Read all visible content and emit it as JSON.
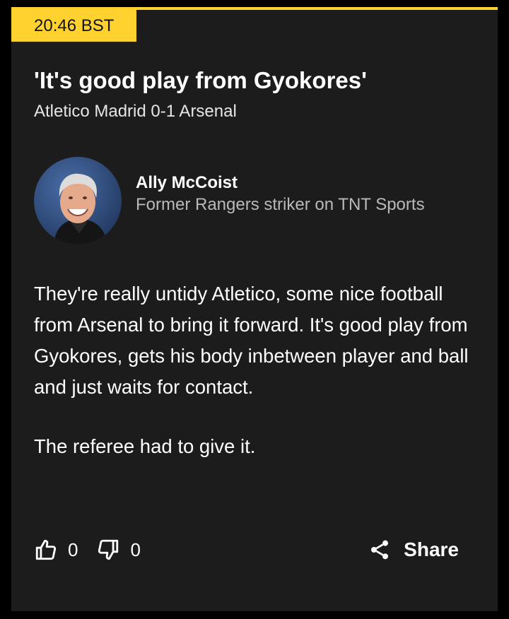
{
  "post": {
    "time": "20:46 BST",
    "title": "'It's good play from Gyokores'",
    "match": "Atletico Madrid 0-1 Arsenal",
    "accent_color": "#ffd230"
  },
  "author": {
    "name": "Ally McCoist",
    "role": "Former Rangers striker on TNT Sports",
    "avatar_icon": "avatar-photo"
  },
  "body": {
    "paragraph_1": "They're really untidy Atletico, some nice football from Arsenal to bring it forward. It's good play from Gyokores, gets his body inbetween player and ball and just waits for contact.",
    "paragraph_2": "The referee had to give it."
  },
  "actions": {
    "like_icon": "thumbs-up-icon",
    "like_count": "0",
    "dislike_icon": "thumbs-down-icon",
    "dislike_count": "0",
    "share_icon": "share-icon",
    "share_label": "Share"
  }
}
